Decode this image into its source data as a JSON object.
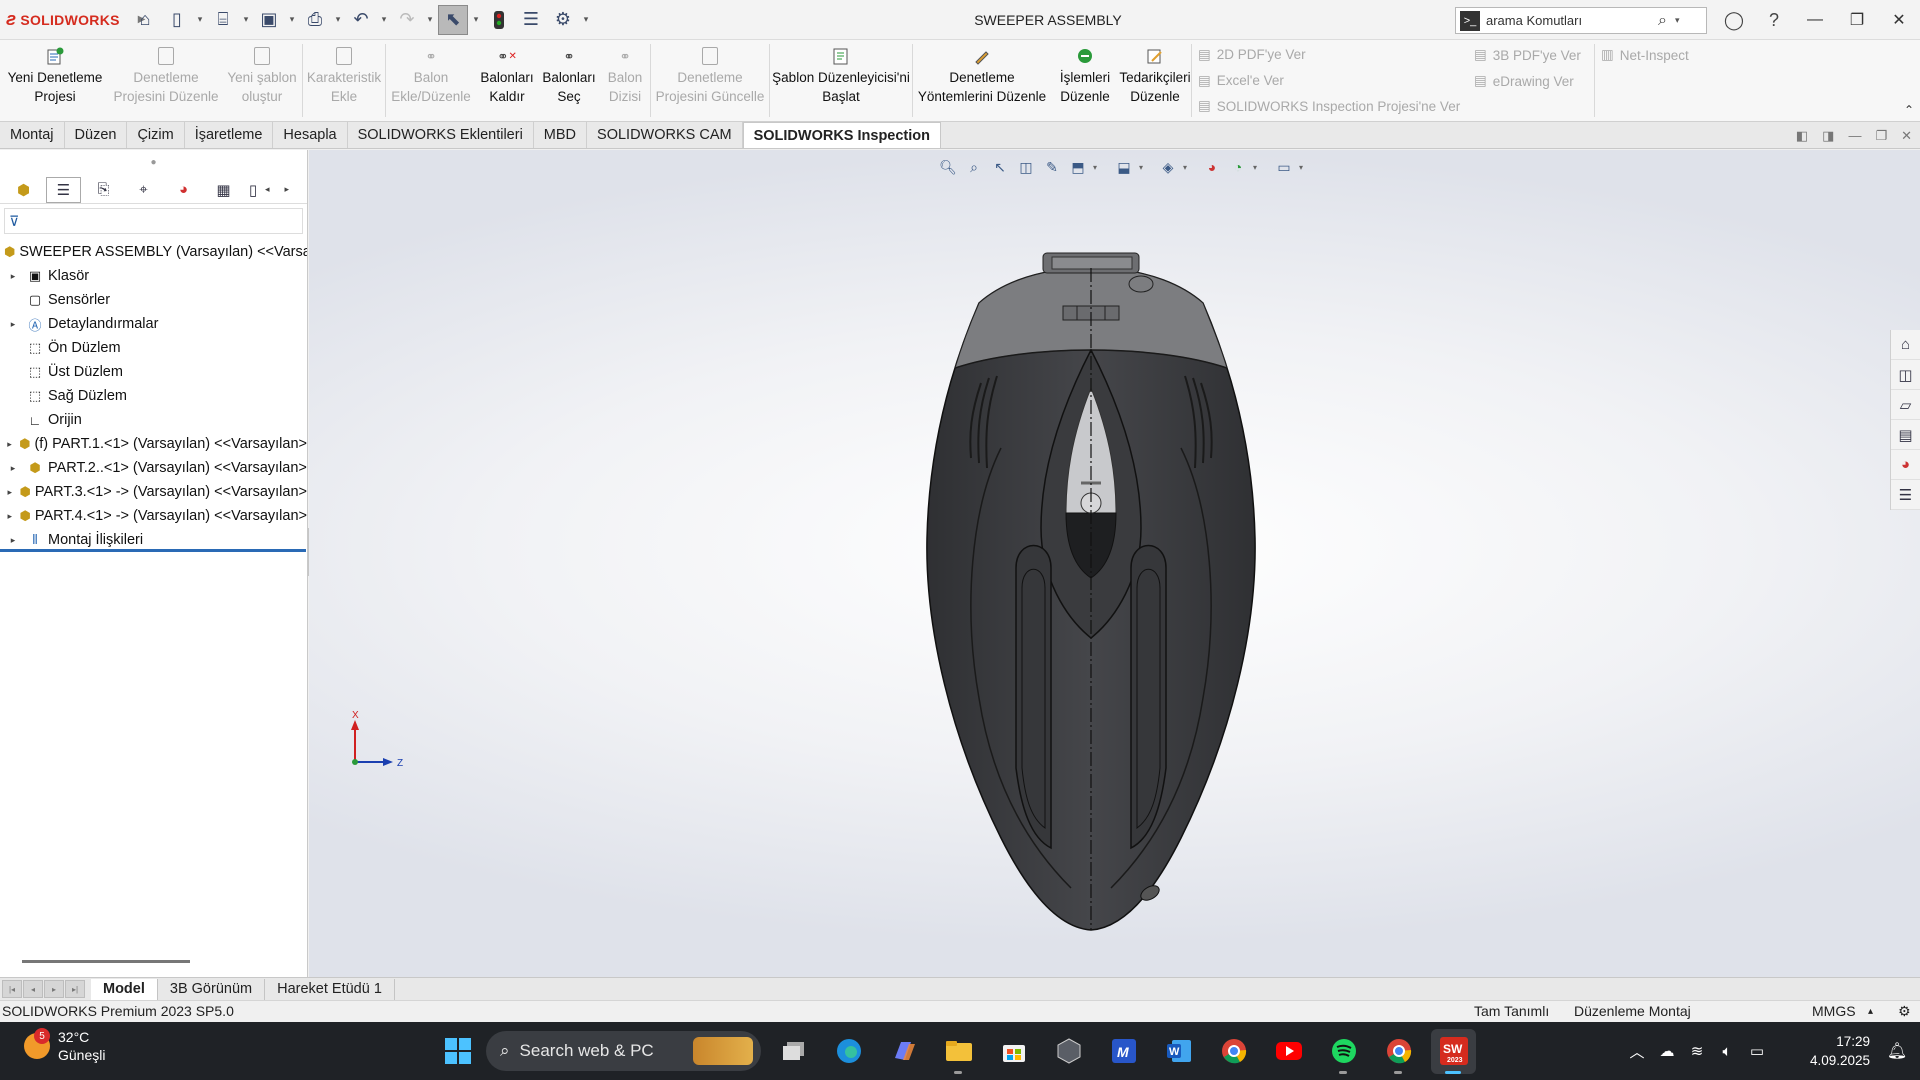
{
  "app": {
    "logo_text": "SOLIDWORKS",
    "window_title": "SWEEPER ASSEMBLY",
    "search_placeholder": "arama Komutları"
  },
  "ribbon": {
    "buttons": [
      {
        "label": "Yeni Denetleme Projesi",
        "enabled": true,
        "icon": "new-inspection-project-icon"
      },
      {
        "label": "Denetleme Projesini Düzenle",
        "enabled": false,
        "icon": "edit-inspection-project-icon"
      },
      {
        "label": "Yeni şablon oluştur",
        "enabled": false,
        "icon": "new-template-icon"
      },
      {
        "label": "Karakteristik Ekle",
        "enabled": false,
        "icon": "add-characteristic-icon"
      },
      {
        "label": "Balon Ekle/Düzenle",
        "enabled": false,
        "icon": "balloon-add-icon"
      },
      {
        "label": "Balonları Kaldır",
        "enabled": true,
        "icon": "balloon-remove-icon"
      },
      {
        "label": "Balonları Seç",
        "enabled": true,
        "icon": "balloon-select-icon"
      },
      {
        "label": "Balon Dizisi",
        "enabled": false,
        "icon": "balloon-sequence-icon"
      },
      {
        "label": "Denetleme Projesini Güncelle",
        "enabled": false,
        "icon": "update-project-icon"
      },
      {
        "label": "Şablon Düzenleyicisi'ni Başlat",
        "enabled": true,
        "icon": "template-editor-icon"
      },
      {
        "label": "Denetleme Yöntemlerini Düzenle",
        "enabled": true,
        "icon": "edit-methods-icon"
      },
      {
        "label": "İşlemleri Düzenle",
        "enabled": true,
        "icon": "edit-operations-icon"
      },
      {
        "label": "Tedarikçileri Düzenle",
        "enabled": true,
        "icon": "edit-vendors-icon"
      }
    ],
    "export_col1": [
      "2D PDF'ye Ver",
      "Excel'e Ver",
      "SOLIDWORKS Inspection Projesi'ne Ver"
    ],
    "export_col2": [
      "3B PDF'ye Ver",
      "eDrawing Ver"
    ],
    "export_col3": [
      "Net-Inspect"
    ]
  },
  "command_tabs": [
    "Montaj",
    "Düzen",
    "Çizim",
    "İşaretleme",
    "Hesapla",
    "SOLIDWORKS Eklentileri",
    "MBD",
    "SOLIDWORKS CAM",
    "SOLIDWORKS Inspection"
  ],
  "active_command_tab": "SOLIDWORKS Inspection",
  "feature_tree": {
    "root": "SWEEPER ASSEMBLY (Varsayılan) <<Varsayılan",
    "items": [
      {
        "label": "Klasör",
        "expandable": true,
        "icon": "history-folder-icon"
      },
      {
        "label": "Sensörler",
        "expandable": false,
        "icon": "sensor-icon"
      },
      {
        "label": "Detaylandırmalar",
        "expandable": true,
        "icon": "annotations-icon"
      },
      {
        "label": "Ön Düzlem",
        "expandable": false,
        "icon": "plane-icon"
      },
      {
        "label": "Üst Düzlem",
        "expandable": false,
        "icon": "plane-icon"
      },
      {
        "label": "Sağ Düzlem",
        "expandable": false,
        "icon": "plane-icon"
      },
      {
        "label": "Orijin",
        "expandable": false,
        "icon": "origin-icon"
      },
      {
        "label": "(f) PART.1.<1> (Varsayılan) <<Varsayılan>",
        "expandable": true,
        "icon": "part-icon"
      },
      {
        "label": "PART.2..<1> (Varsayılan) <<Varsayılan>",
        "expandable": true,
        "icon": "part-icon"
      },
      {
        "label": "PART.3.<1> -> (Varsayılan) <<Varsayılan>",
        "expandable": true,
        "icon": "part-icon"
      },
      {
        "label": "PART.4.<1> -> (Varsayılan) <<Varsayılan>",
        "expandable": true,
        "icon": "part-icon"
      },
      {
        "label": "Montaj İlişkileri",
        "expandable": true,
        "icon": "mates-icon"
      }
    ]
  },
  "triad": {
    "x_label": "X",
    "z_label": "Z"
  },
  "bottom_tabs": [
    "Model",
    "3B Görünüm",
    "Hareket Etüdü 1"
  ],
  "active_bottom_tab": "Model",
  "statusbar": {
    "version": "SOLIDWORKS Premium 2023 SP5.0",
    "definition": "Tam Tanımlı",
    "mode": "Düzenleme Montaj",
    "units": "MMGS"
  },
  "taskbar": {
    "weather_temp": "32°C",
    "weather_desc": "Güneşli",
    "weather_badge": "5",
    "search_text": "Search web & PC",
    "time": "17:29",
    "date": "4.09.2025",
    "sw_app_label": "SW",
    "sw_app_year": "2023"
  },
  "colors": {
    "accent_blue": "#2a6ab5",
    "sw_red": "#d52b1e",
    "model_body": "#3c3d40",
    "model_top": "#7a7b7e"
  }
}
